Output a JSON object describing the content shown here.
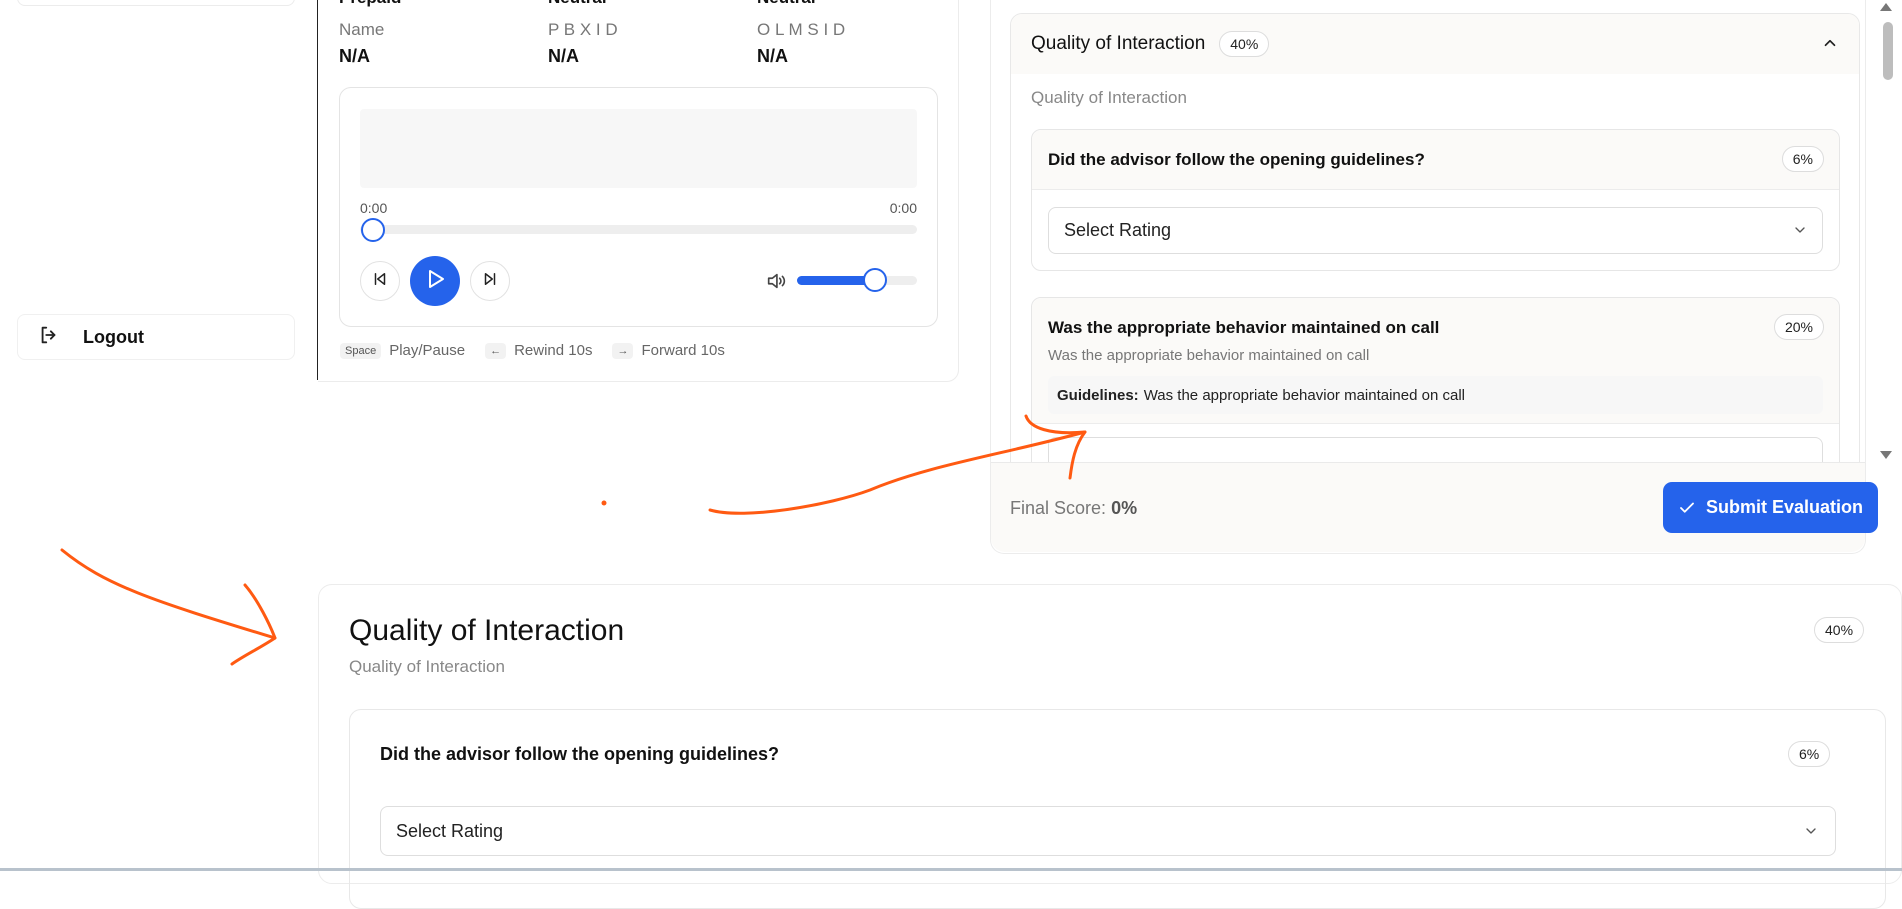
{
  "sidebar": {
    "logout_label": "Logout",
    "logout_icon": "logout-icon"
  },
  "call_info": {
    "headers": [
      "Prepaid",
      "Neutral",
      "Neutral"
    ],
    "fields": [
      {
        "label": "Name",
        "value": "N/A"
      },
      {
        "label": "P B X I D",
        "value": "N/A"
      },
      {
        "label": "O L M S I D",
        "value": "N/A"
      }
    ]
  },
  "player": {
    "current_time": "0:00",
    "duration": "0:00",
    "progress": 0,
    "volume": 0.8,
    "shortcuts": [
      {
        "key": "Space",
        "label": "Play/Pause"
      },
      {
        "key": "←",
        "label": "Rewind 10s"
      },
      {
        "key": "→",
        "label": "Forward 10s"
      }
    ]
  },
  "evaluation": {
    "section": {
      "title": "Quality of Interaction",
      "weight": "40%",
      "subtitle": "Quality of Interaction"
    },
    "questions": [
      {
        "title": "Did the advisor follow the opening guidelines?",
        "weight": "6%",
        "select_placeholder": "Select Rating"
      },
      {
        "title": "Was the appropriate behavior maintained on call",
        "weight": "20%",
        "description": "Was the appropriate behavior maintained on call",
        "guidelines_label": "Guidelines:",
        "guidelines_text": "Was the appropriate behavior maintained on call"
      }
    ],
    "final_score_label": "Final Score:",
    "final_score_value": "0%",
    "submit_label": "Submit Evaluation"
  },
  "bottom_section": {
    "title": "Quality of Interaction",
    "subtitle": "Quality of Interaction",
    "weight": "40%",
    "question": {
      "title": "Did the advisor follow the opening guidelines?",
      "weight": "6%",
      "select_placeholder": "Select Rating"
    }
  },
  "colors": {
    "accent": "#2563eb",
    "annotation": "#ff5a12"
  }
}
